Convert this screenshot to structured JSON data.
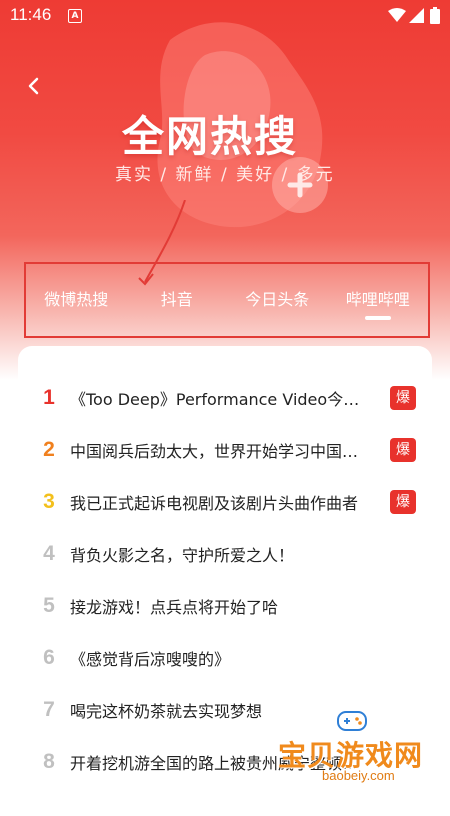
{
  "status_bar": {
    "time": "11:46",
    "notification_icon": "a-icon",
    "icons": [
      "wifi-icon",
      "signal-icon",
      "battery-icon"
    ]
  },
  "header": {
    "back_icon": "back-chevron-icon",
    "title": "全网热搜",
    "subtitle": "真实 / 新鲜 / 美好 / 多元"
  },
  "tabs": [
    {
      "label": "微博热搜",
      "active": false
    },
    {
      "label": "抖音",
      "active": false
    },
    {
      "label": "今日头条",
      "active": false
    },
    {
      "label": "哔哩哔哩",
      "active": true
    }
  ],
  "hot_list": [
    {
      "rank": "1",
      "title": "《Too Deep》Performance Video今日上线",
      "badge": "爆",
      "color": "#e8322c"
    },
    {
      "rank": "2",
      "title": "中国阅兵后劲太大，世界开始学习中国阅兵",
      "badge": "爆",
      "color": "#f0801e"
    },
    {
      "rank": "3",
      "title": "我已正式起诉电视剧及该剧片头曲作曲者",
      "badge": "爆",
      "color": "#f3c01c"
    },
    {
      "rank": "4",
      "title": "背负火影之名，守护所爱之人！",
      "badge": "",
      "color": "#c0c0c0"
    },
    {
      "rank": "5",
      "title": "接龙游戏！点兵点将开始了哈",
      "badge": "",
      "color": "#c0c0c0"
    },
    {
      "rank": "6",
      "title": "《感觉背后凉嗖嗖的》",
      "badge": "",
      "color": "#c0c0c0"
    },
    {
      "rank": "7",
      "title": "喝完这杯奶茶就去实现梦想",
      "badge": "",
      "color": "#c0c0c0"
    },
    {
      "rank": "8",
      "title": "开着挖机游全国的路上被贵州威宁整顿了！",
      "badge": "",
      "color": "#c0c0c0"
    }
  ],
  "watermark": {
    "text": "宝贝游戏网",
    "url": "baobeiy.com"
  },
  "colors": {
    "accent": "#e8322c",
    "rank1": "#e8322c",
    "rank2": "#f0801e",
    "rank3": "#f3c01c",
    "rank_other": "#c0c0c0"
  }
}
